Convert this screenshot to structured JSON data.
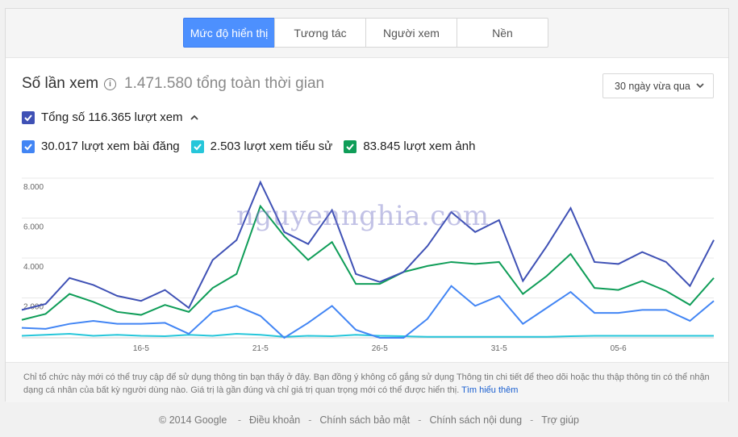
{
  "tabs": [
    {
      "label": "Mức độ hiển thị",
      "active": true
    },
    {
      "label": "Tương tác",
      "active": false
    },
    {
      "label": "Người xem",
      "active": false
    },
    {
      "label": "Nền",
      "active": false
    }
  ],
  "header": {
    "title": "Số lần xem",
    "total": "1.471.580 tổng toàn thời gian",
    "range": "30 ngày vừa qua"
  },
  "totals": {
    "label": "Tổng số 116.365 lượt xem",
    "color": "#3f51b5"
  },
  "series_toggles": [
    {
      "label": "30.017 lượt xem bài đăng",
      "color": "#4285f4"
    },
    {
      "label": "2.503 lượt xem tiểu sử",
      "color": "#26c6da"
    },
    {
      "label": "83.845 lượt xem ảnh",
      "color": "#0f9d58"
    }
  ],
  "watermark": "nguyennghia.com",
  "note": {
    "text": "Chỉ tổ chức này mới có thể truy cập để sử dụng thông tin bạn thấy ở đây. Bạn đồng ý không cố gắng sử dụng Thông tin chi tiết để theo dõi hoặc thu thập thông tin có thể nhận dạng cá nhân của bất kỳ người dùng nào. Giá trị là gần đúng và chỉ giá trị quan trọng mới có thể được hiển thị.",
    "link": "Tìm hiểu thêm"
  },
  "footer": {
    "copyright": "© 2014 Google",
    "links": [
      "Điều khoản",
      "Chính sách bảo mật",
      "Chính sách nội dung",
      "Trợ giúp"
    ]
  },
  "chart_data": {
    "type": "line",
    "x": [
      "11-5",
      "12-5",
      "13-5",
      "14-5",
      "15-5",
      "16-5",
      "17-5",
      "18-5",
      "19-5",
      "20-5",
      "21-5",
      "22-5",
      "23-5",
      "24-5",
      "25-5",
      "26-5",
      "27-5",
      "28-5",
      "29-5",
      "30-5",
      "31-5",
      "01-6",
      "02-6",
      "03-6",
      "04-6",
      "05-6",
      "06-6",
      "07-6",
      "08-6",
      "09-6"
    ],
    "xticks": [
      "16-5",
      "21-5",
      "26-5",
      "31-5",
      "05-6"
    ],
    "yticks": [
      "2.000",
      "4.000",
      "6.000",
      "8.000"
    ],
    "ylim": [
      0,
      8000
    ],
    "series": [
      {
        "color": "#3f51b5",
        "values": [
          1400,
          1700,
          3000,
          2650,
          2100,
          1850,
          2400,
          1500,
          3900,
          4900,
          7800,
          5300,
          4700,
          6400,
          3200,
          2800,
          3300,
          4600,
          6300,
          5300,
          5900,
          2850,
          4600,
          6500,
          3800,
          3700,
          4300,
          3800,
          2600,
          4900
        ]
      },
      {
        "color": "#0f9d58",
        "values": [
          900,
          1200,
          2200,
          1800,
          1300,
          1150,
          1650,
          1300,
          2500,
          3200,
          6600,
          5100,
          3900,
          4800,
          2700,
          2700,
          3300,
          3600,
          3800,
          3700,
          3800,
          2200,
          3100,
          4200,
          2500,
          2400,
          2850,
          2350,
          1650,
          3000
        ]
      },
      {
        "color": "#4285f4",
        "values": [
          500,
          450,
          700,
          850,
          700,
          700,
          750,
          200,
          1300,
          1600,
          1100,
          0,
          750,
          1600,
          400,
          0,
          0,
          950,
          2600,
          1600,
          2100,
          700,
          1500,
          2300,
          1250,
          1250,
          1400,
          1400,
          850,
          1850
        ]
      },
      {
        "color": "#26c6da",
        "values": [
          100,
          150,
          200,
          100,
          150,
          100,
          80,
          150,
          100,
          200,
          150,
          50,
          100,
          80,
          150,
          100,
          80,
          50,
          50,
          50,
          50,
          50,
          50,
          80,
          100,
          100,
          100,
          100,
          100,
          100
        ]
      }
    ]
  }
}
